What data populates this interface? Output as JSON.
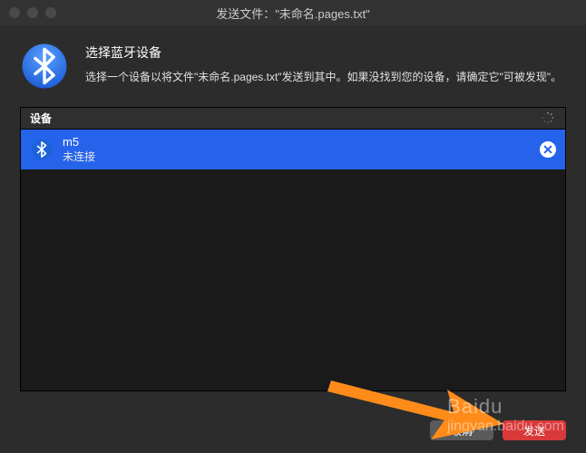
{
  "window": {
    "title": "发送文件：\"未命名.pages.txt\""
  },
  "header": {
    "title": "选择蓝牙设备",
    "description": "选择一个设备以将文件\"未命名.pages.txt\"发送到其中。如果没找到您的设备，请确定它\"可被发现\"。"
  },
  "list": {
    "header_label": "设备"
  },
  "devices": [
    {
      "name": "m5",
      "status": "未连接",
      "selected": true
    }
  ],
  "footer": {
    "cancel_label": "取消",
    "send_label": "发送"
  },
  "watermark": {
    "brand": "Baidu",
    "sub": "jingyan.baidu.com"
  }
}
